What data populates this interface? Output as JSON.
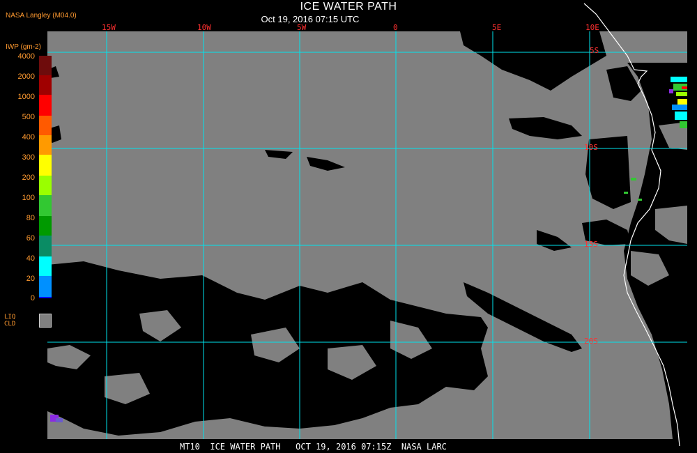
{
  "header": {
    "title": "ICE WATER PATH",
    "subtitle": "Oct 19, 2016 07:15 UTC",
    "source": "NASA Langley (M04.0)"
  },
  "legend": {
    "title": "IWP (gm-2)",
    "ticks": [
      "4000",
      "2000",
      "1000",
      "500",
      "400",
      "300",
      "200",
      "100",
      "80",
      "60",
      "40",
      "20",
      "0"
    ],
    "colors": [
      "#6e0c0c",
      "#a00000",
      "#ff0000",
      "#ff5a00",
      "#ff9a00",
      "#ffff00",
      "#9aff00",
      "#32c832",
      "#009a00",
      "#0a8c64",
      "#00ffff",
      "#0090ff",
      "#0000ff",
      "#8a2be2"
    ],
    "liq_label_1": "LIQ",
    "liq_label_2": "CLD",
    "liq_color": "#808080"
  },
  "map": {
    "longitude_labels": [
      "15W",
      "10W",
      "5W",
      "0",
      "5E",
      "10E"
    ],
    "latitude_labels": [
      "5S",
      "10S",
      "15S",
      "20S"
    ],
    "grid_color": "#00e5ee",
    "label_color": "#ff3030",
    "coast_color": "#ffffff",
    "clear_color": "#000000",
    "cloud_color": "#808080"
  },
  "footer": {
    "text": "MT10  ICE WATER PATH   OCT 19, 2016 07:15Z  NASA LARC"
  }
}
